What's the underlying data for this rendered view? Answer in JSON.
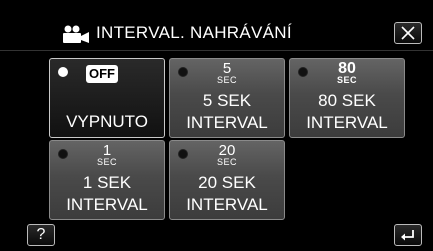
{
  "header": {
    "icon": "movie-camera-icon",
    "title": "INTERVAL. NAHRÁVÁNÍ",
    "close_icon": "close-icon"
  },
  "options": [
    {
      "id": "off",
      "badge": "OFF",
      "label": "VYPNUTO",
      "selected": true
    },
    {
      "id": "5s",
      "num": "5",
      "unit": "SEC",
      "line1": "5 SEK",
      "line2": "INTERVAL",
      "selected": false
    },
    {
      "id": "80s",
      "num": "80",
      "unit": "SEC",
      "line1": "80 SEK",
      "line2": "INTERVAL",
      "selected": false
    },
    {
      "id": "1s",
      "num": "1",
      "unit": "SEC",
      "line1": "1 SEK",
      "line2": "INTERVAL",
      "selected": false
    },
    {
      "id": "20s",
      "num": "20",
      "unit": "SEC",
      "line1": "20 SEK",
      "line2": "INTERVAL",
      "selected": false
    }
  ],
  "footer": {
    "help_label": "?",
    "help_icon": "help-icon",
    "back_icon": "return-arrow-icon"
  },
  "colors": {
    "background": "#000000",
    "tile": "#4a4a4a",
    "text": "#ffffff"
  }
}
